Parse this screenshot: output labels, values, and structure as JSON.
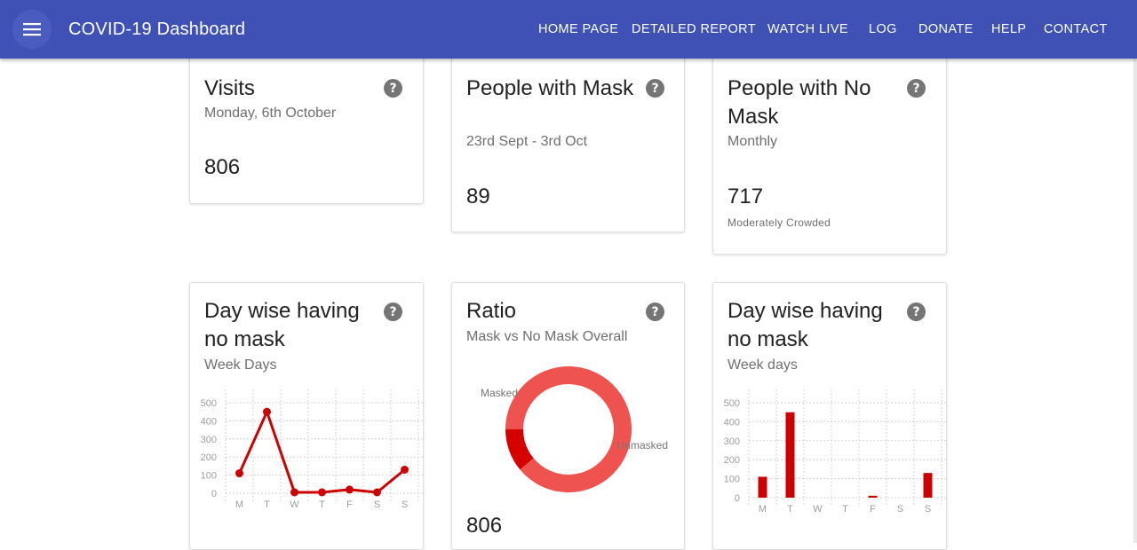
{
  "app": {
    "title": "COVID-19 Dashboard",
    "nav": [
      "HOME PAGE",
      "DETAILED REPORT",
      "WATCH LIVE",
      "LOG",
      "DONATE",
      "HELP",
      "CONTACT"
    ]
  },
  "icons": {
    "menu": "menu-icon",
    "help": "help-circle-icon",
    "help_glyph": "?"
  },
  "colors": {
    "appbar": "#3f51b5",
    "series": "#cc0000",
    "donut_unmasked": "#ef5350",
    "donut_masked": "#d50000"
  },
  "cards": {
    "visits": {
      "title": "Visits",
      "subtitle": "Monday, 6th October",
      "value": "806"
    },
    "mask": {
      "title": "People with Mask",
      "subtitle": "23rd Sept - 3rd Oct",
      "value": "89"
    },
    "nomask": {
      "title": "People with No Mask",
      "subtitle": "Monthly",
      "value": "717",
      "note": "Moderately Crowded"
    },
    "line_chart": {
      "title": "Day wise having no mask",
      "subtitle": "Week Days"
    },
    "ratio": {
      "title": "Ratio",
      "subtitle": "Mask vs No Mask Overall",
      "value": "806"
    },
    "bar_chart": {
      "title": "Day wise having no mask",
      "subtitle": "Week days"
    }
  },
  "chart_data": [
    {
      "type": "line",
      "categories": [
        "M",
        "T",
        "W",
        "T",
        "F",
        "S",
        "S"
      ],
      "values": [
        110,
        450,
        5,
        5,
        20,
        5,
        130
      ],
      "yticks": [
        0,
        100,
        200,
        300,
        400,
        500
      ],
      "ylim": [
        0,
        500
      ],
      "grid": true
    },
    {
      "type": "pie",
      "labels": [
        "Masked",
        "Unmasked"
      ],
      "values": [
        89,
        717
      ]
    },
    {
      "type": "bar",
      "categories": [
        "M",
        "T",
        "W",
        "T",
        "F",
        "S",
        "S"
      ],
      "values": [
        110,
        450,
        0,
        0,
        10,
        0,
        130
      ],
      "yticks": [
        0,
        100,
        200,
        300,
        400,
        500
      ],
      "ylim": [
        0,
        500
      ],
      "grid": true
    }
  ]
}
